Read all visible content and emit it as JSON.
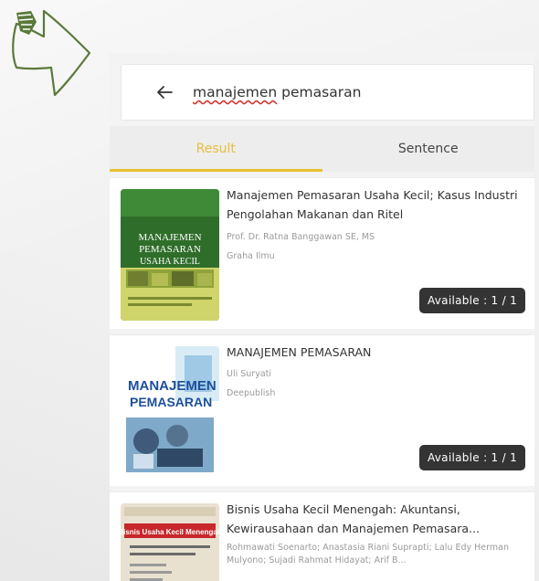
{
  "search": {
    "query_word1": "manajemen",
    "query_word2": "pemasaran"
  },
  "tabs": [
    {
      "label": "Result"
    },
    {
      "label": "Sentence"
    }
  ],
  "results": [
    {
      "title": "Manajemen Pemasaran Usaha Kecil; Kasus Industri Pengolahan Makanan dan Ritel",
      "authors": "Prof. Dr. Ratna Banggawan SE, MS",
      "publisher": "Graha Ilmu",
      "availability": "Available : 1 / 1",
      "cover_text": [
        "MANAJEMEN",
        "PEMASARAN",
        "USAHA KECIL"
      ]
    },
    {
      "title": "MANAJEMEN PEMASARAN",
      "authors": "Uli Suryati",
      "publisher": "Deepublish",
      "availability": "Available : 1 / 1",
      "cover_text": [
        "MANAJEMEN",
        "PEMASARAN"
      ]
    },
    {
      "title": "Bisnis Usaha Kecil Menengah: Akuntansi, Kewirausahaan dan Manajemen Pemasara...",
      "authors": "Rohmawati Soenarto; Anastasia Riani Suprapti; Lalu Edy Herman Mulyono; Sujadi Rahmat Hidayat; Arif B...",
      "publisher": "",
      "cover_text": [
        "Bisnis Usaha Kecil Menengah"
      ]
    }
  ],
  "colors": {
    "accent": "#e8c12f",
    "badge_bg": "#343434",
    "arrow_green": "#5a7a3a"
  }
}
